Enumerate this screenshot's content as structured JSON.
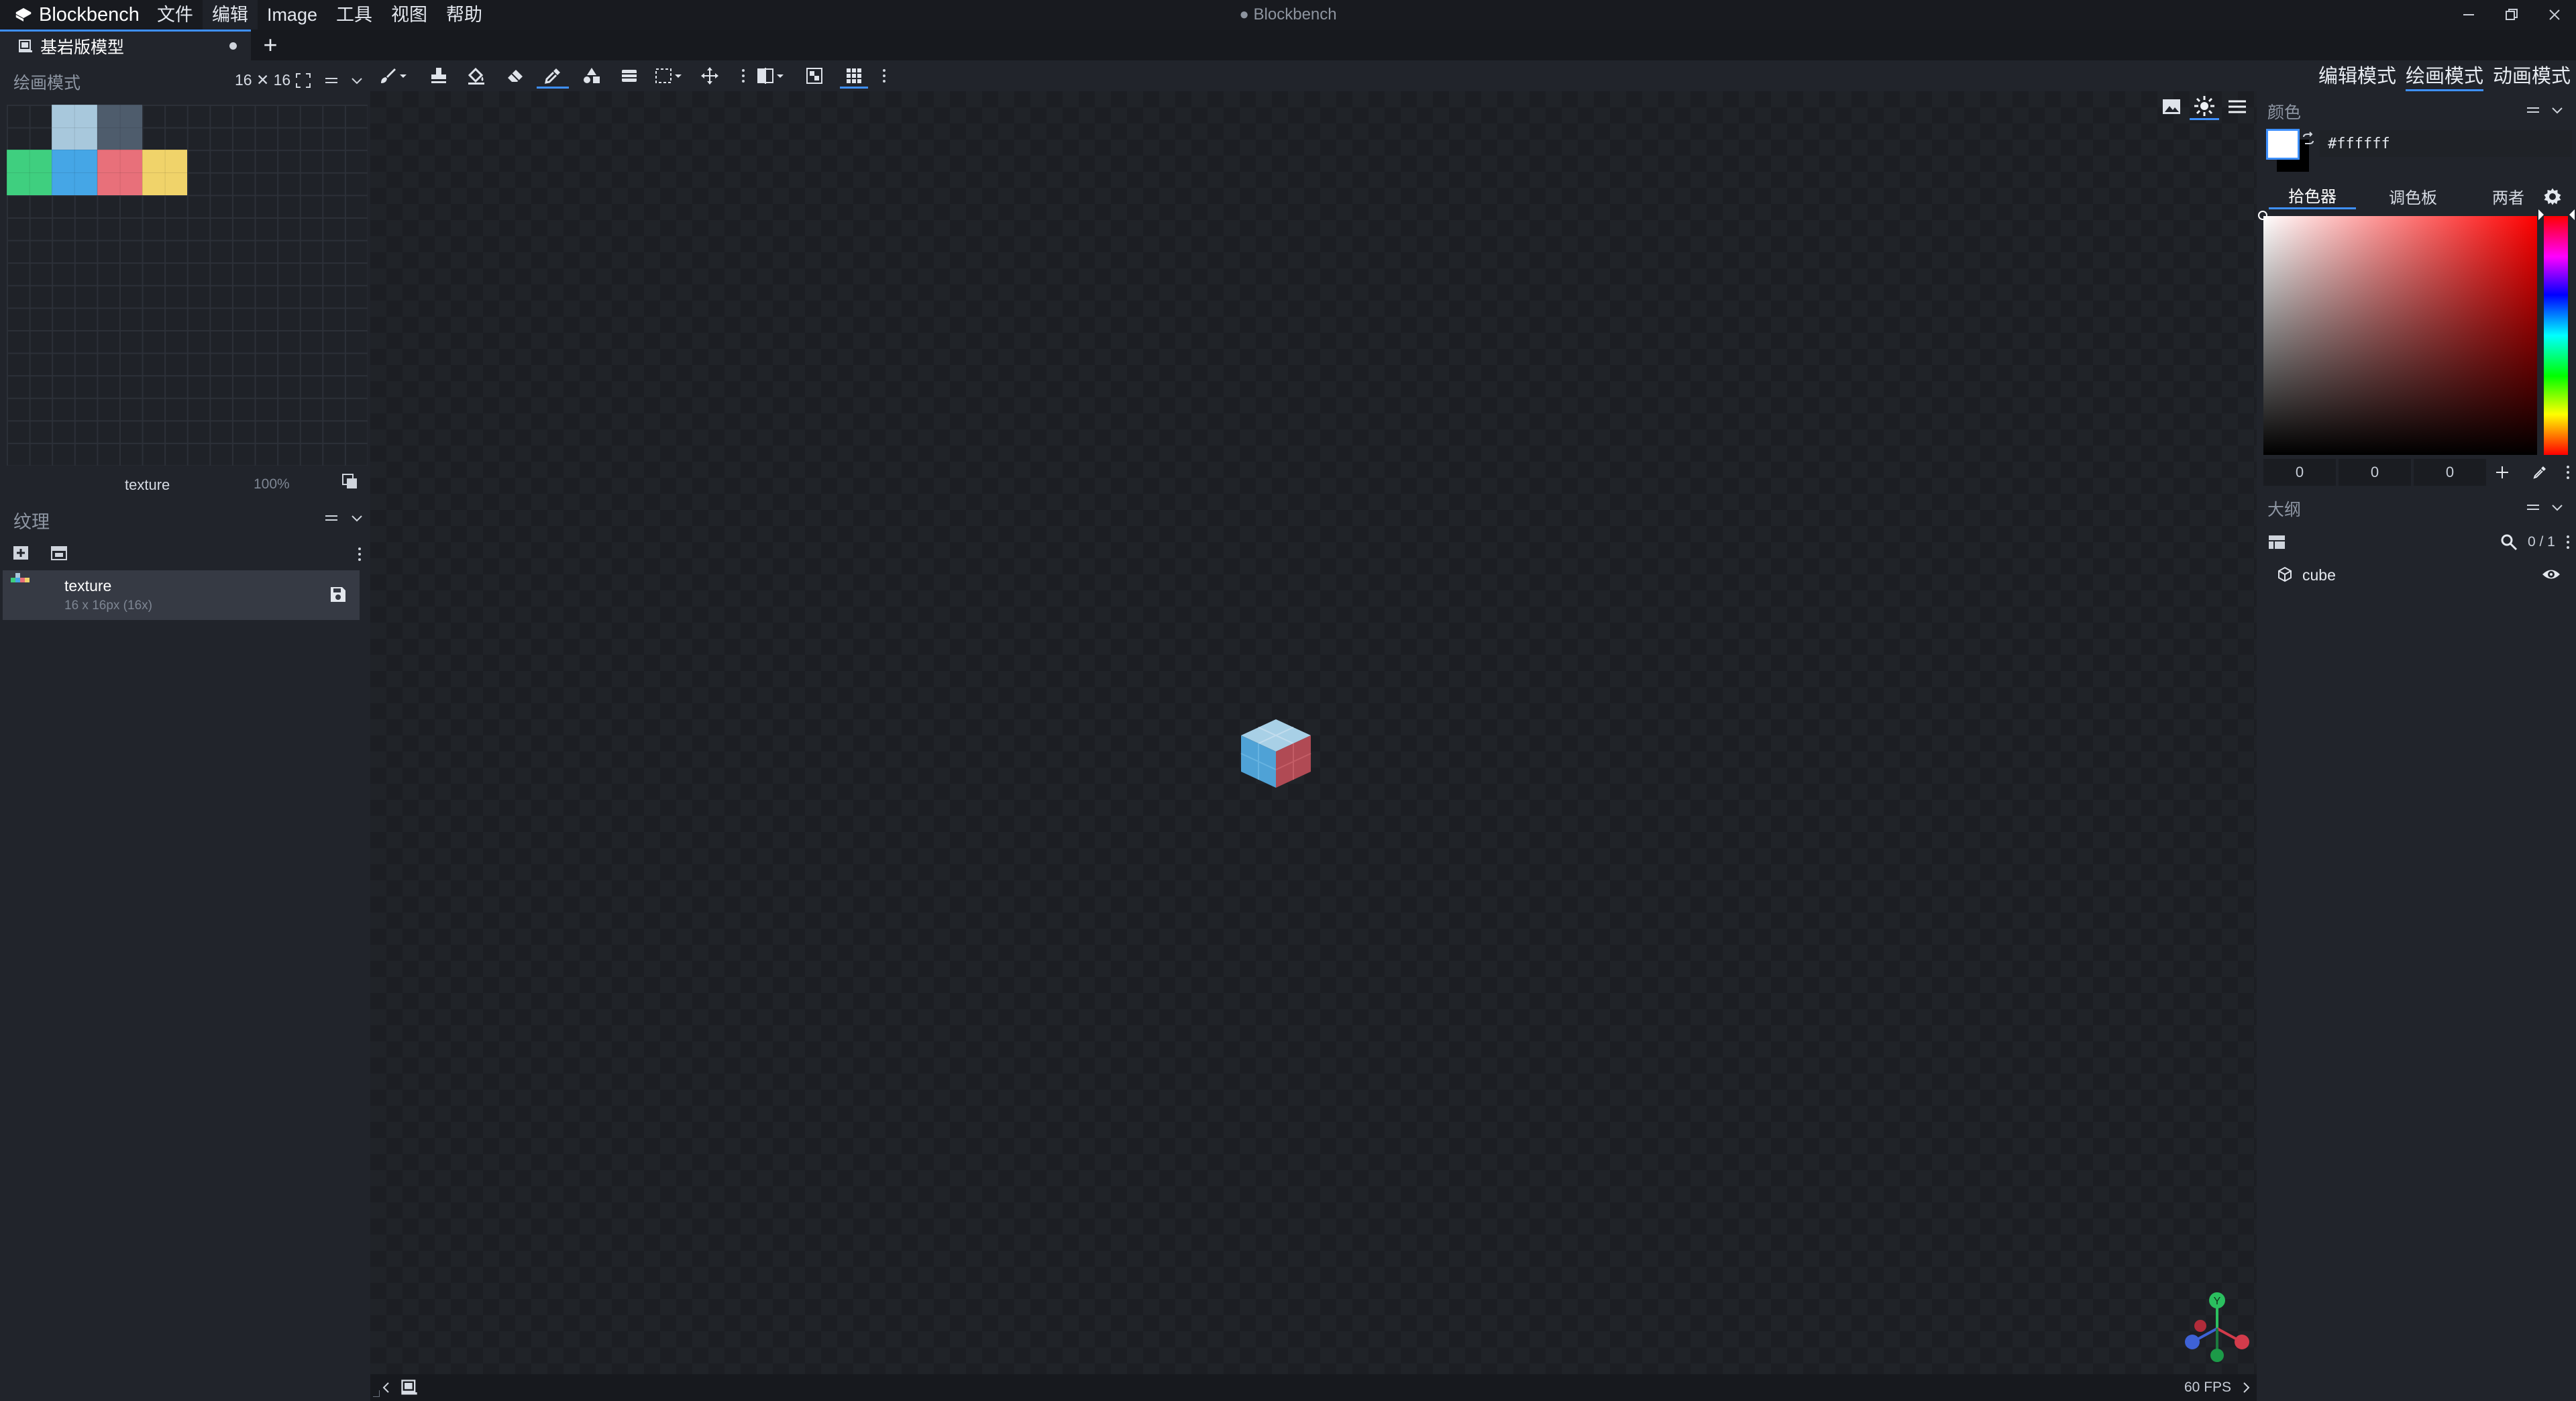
{
  "app": {
    "name": "Blockbench",
    "window_title": "● Blockbench"
  },
  "menu": {
    "file": "文件",
    "edit": "编辑",
    "image": "Image",
    "tools": "工具",
    "view": "视图",
    "help": "帮助"
  },
  "tab": {
    "label": "基岩版模型",
    "add": "+"
  },
  "left": {
    "paint_title": "绘画模式",
    "uv_size": "16 ✕ 16",
    "texture_name": "texture",
    "zoom": "100%",
    "textures_title": "纹理",
    "texture_item": {
      "name": "texture",
      "meta": "16 x 16px (16x)"
    },
    "uv_pixels": [
      {
        "row": 0,
        "col": 1,
        "color": "#a8c8dc"
      },
      {
        "row": 0,
        "col": 2,
        "color": "#4e5c6c"
      },
      {
        "row": 1,
        "col": 1,
        "color": "#a8c8dc"
      },
      {
        "row": 1,
        "col": 2,
        "color": "#4e5c6c"
      },
      {
        "row": 2,
        "col": 0,
        "color": "#3fcf7f"
      },
      {
        "row": 2,
        "col": 1,
        "color": "#45a6e6"
      },
      {
        "row": 2,
        "col": 2,
        "color": "#e8707a"
      },
      {
        "row": 2,
        "col": 3,
        "color": "#f0d36a"
      },
      {
        "row": 3,
        "col": 0,
        "color": "#3fcf7f"
      },
      {
        "row": 3,
        "col": 1,
        "color": "#45a6e6"
      },
      {
        "row": 3,
        "col": 2,
        "color": "#e8707a"
      },
      {
        "row": 3,
        "col": 3,
        "color": "#f0d36a"
      }
    ]
  },
  "right": {
    "modes": {
      "edit": "编辑模式",
      "paint": "绘画模式",
      "animate": "动画模式"
    },
    "color_title": "颜色",
    "hex_value": "#ffffff",
    "color_tabs": {
      "picker": "拾色器",
      "palette": "调色板",
      "both": "两者"
    },
    "rgb": {
      "r": "0",
      "g": "0",
      "b": "0"
    },
    "outline_title": "大纲",
    "outline_count": "0 / 1",
    "outline_item": "cube"
  },
  "status": {
    "fps": "60 FPS"
  },
  "gizmo": {
    "y": "Y"
  },
  "colors": {
    "accent": "#3e90ff",
    "bg": "#1b1d23",
    "panel": "#21242b"
  }
}
